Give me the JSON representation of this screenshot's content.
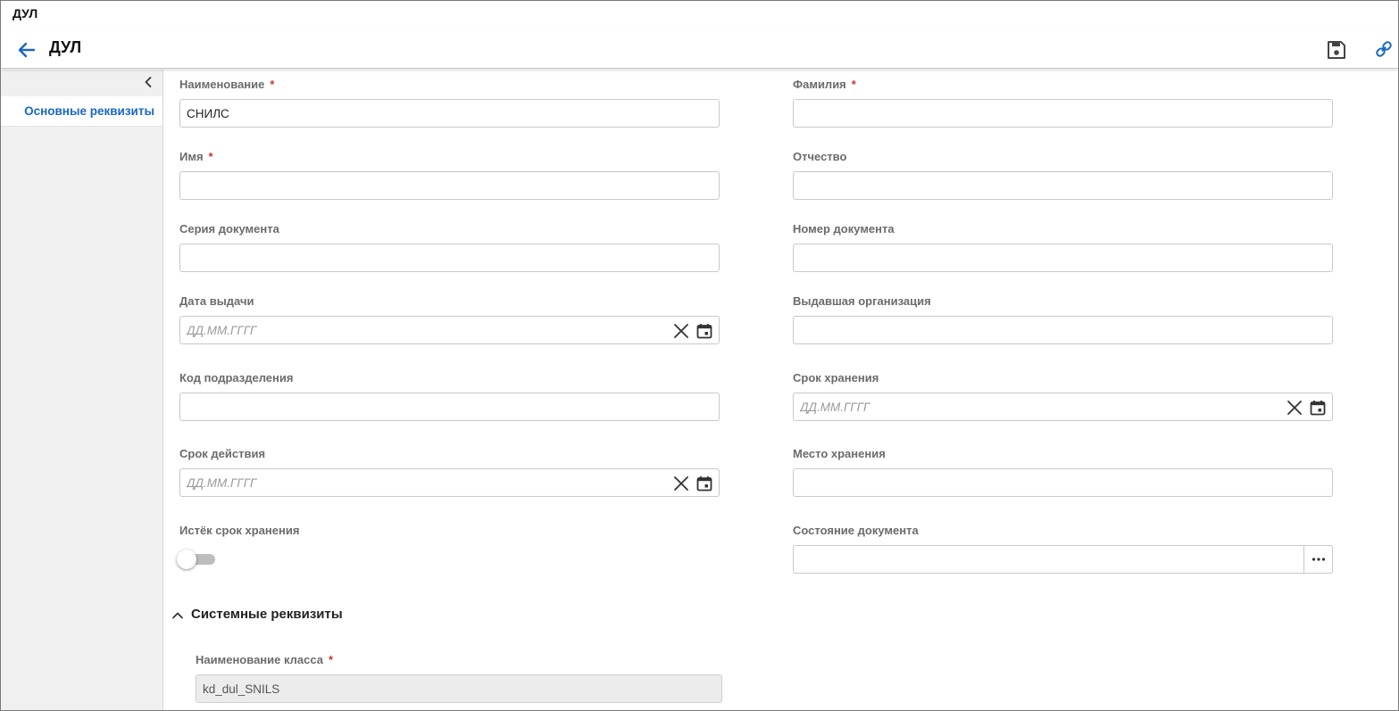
{
  "window": {
    "title": "ДУЛ"
  },
  "header": {
    "title": "ДУЛ"
  },
  "sidebar": {
    "items": [
      {
        "label": "Основные реквизиты"
      }
    ]
  },
  "form": {
    "naimenovanie": {
      "label": "Наименование",
      "value": "СНИЛС",
      "required": "*"
    },
    "familiya": {
      "label": "Фамилия",
      "value": "",
      "required": "*"
    },
    "imya": {
      "label": "Имя",
      "value": "",
      "required": "*"
    },
    "otchestvo": {
      "label": "Отчество",
      "value": ""
    },
    "seriya": {
      "label": "Серия документа",
      "value": ""
    },
    "nomer": {
      "label": "Номер документа",
      "value": ""
    },
    "data_vydachi": {
      "label": "Дата выдачи",
      "placeholder": "ДД.ММ.ГГГГ"
    },
    "vydavshaya_org": {
      "label": "Выдавшая организация",
      "value": ""
    },
    "kod_podrazdeleniya": {
      "label": "Код подразделения",
      "value": ""
    },
    "srok_hraneniya": {
      "label": "Срок хранения",
      "placeholder": "ДД.ММ.ГГГГ"
    },
    "srok_deystviya": {
      "label": "Срок действия",
      "placeholder": "ДД.ММ.ГГГГ"
    },
    "mesto_hraneniya": {
      "label": "Место хранения",
      "value": ""
    },
    "istek_srok": {
      "label": "Истёк срок хранения",
      "checked": false
    },
    "sostoyanie": {
      "label": "Состояние документа",
      "value": ""
    }
  },
  "system_section": {
    "title": "Системные реквизиты",
    "class_name": {
      "label": "Наименование класса",
      "value": "kd_dul_SNILS",
      "required": "*"
    }
  },
  "colors": {
    "accent": "#1a66c2",
    "required": "#c0392b",
    "label": "#6b6b6b"
  }
}
